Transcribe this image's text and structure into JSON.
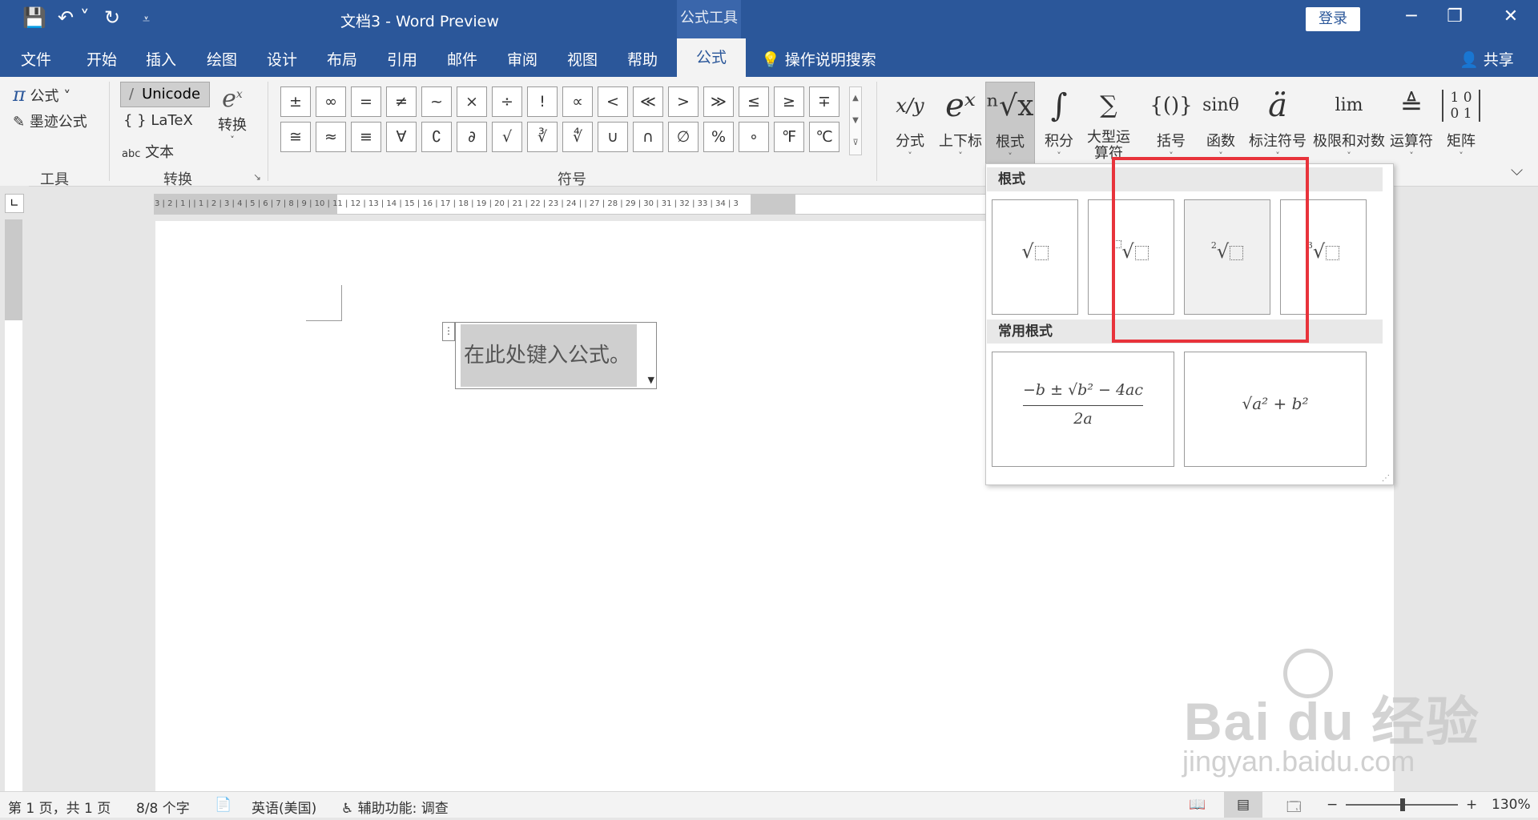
{
  "window": {
    "title": "文档3  -  Word Preview",
    "context_tab": "公式工具",
    "login": "登录",
    "qa_save": "💾",
    "qa_undo": "↶ ˅",
    "qa_redo": "↻",
    "qa_more": "⩡",
    "win_min": "─",
    "win_restore": "❐",
    "win_close": "✕"
  },
  "tabs": [
    "文件",
    "开始",
    "插入",
    "绘图",
    "设计",
    "布局",
    "引用",
    "邮件",
    "审阅",
    "视图",
    "帮助"
  ],
  "active_tab": "公式",
  "tellme": "操作说明搜索",
  "share": "共享",
  "ribbon": {
    "tools": {
      "equation": "公式 ˅",
      "ink": "墨迹公式",
      "label": "工具",
      "pi": "π"
    },
    "convert": {
      "unicode": "Unicode",
      "latex": "LaTeX",
      "text": "文本",
      "convert": "转换",
      "label": "转换",
      "abc": "abc",
      "braces": "{ }",
      "slash": "/"
    },
    "symbols": {
      "label": "符号",
      "row1": [
        "±",
        "∞",
        "=",
        "≠",
        "~",
        "×",
        "÷",
        "!",
        "∝",
        "<",
        "≪",
        ">",
        "≫",
        "≤",
        "≥",
        "∓"
      ],
      "row2": [
        "≅",
        "≈",
        "≡",
        "∀",
        "∁",
        "∂",
        "√",
        "∛",
        "∜",
        "∪",
        "∩",
        "∅",
        "%",
        "∘",
        "℉",
        "℃"
      ]
    },
    "structures": [
      {
        "glyph": "x/y",
        "label": "分式"
      },
      {
        "glyph": "eˣ",
        "label": "上下标"
      },
      {
        "glyph": "ⁿ√x",
        "label": "根式"
      },
      {
        "glyph": "∫",
        "label": "积分"
      },
      {
        "glyph": "∑",
        "label": "大型运算符"
      },
      {
        "glyph": "{()}",
        "label": "括号"
      },
      {
        "glyph": "sinθ",
        "label": "函数"
      },
      {
        "glyph": "ä",
        "label": "标注符号"
      },
      {
        "glyph": "lim",
        "label": "极限和对数"
      },
      {
        "glyph": "≜",
        "label": "运算符"
      },
      {
        "glyph": "[10 01]",
        "label": "矩阵"
      }
    ]
  },
  "ruler": {
    "numbers": "3 | 2 | 1 |   | 1 | 2 | 3 | 4 | 5 | 6 | 7 | 8 | 9 | 10 | 11 | 12 | 13 | 14 | 15 | 16 | 17 | 18 | 19 | 20 | 21 | 22 | 23 | 24 |    | 27 | 28 | 29 | 30 | 31 | 32 | 33 | 34 | 3",
    "tab_icon": "∟"
  },
  "document": {
    "equation_placeholder": "在此处键入公式。"
  },
  "gallery": {
    "section1": "根式",
    "section2": "常用根式",
    "root_sign": "√",
    "index_sq": "2",
    "index_cube": "3",
    "quadratic_num": "−b ± √b² − 4ac",
    "quadratic_den": "2a",
    "pythag": "√a² + b²"
  },
  "status": {
    "page": "第 1 页，共 1 页",
    "words": "8/8 个字",
    "lang": "英语(美国)",
    "access": "辅助功能: 调查",
    "zoom": "130%",
    "minus": "−",
    "plus": "+"
  },
  "watermark": {
    "brand": "Bai  du 经验",
    "sub": "jingyan.baidu.com"
  }
}
